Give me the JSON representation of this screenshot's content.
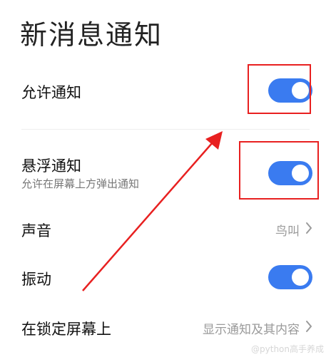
{
  "page": {
    "title": "新消息通知"
  },
  "settings": {
    "allow_notify": {
      "title": "允许通知",
      "enabled": true
    },
    "float_notify": {
      "title": "悬浮通知",
      "subtitle": "允许在屏幕上方弹出通知",
      "enabled": true
    },
    "sound": {
      "title": "声音",
      "value": "鸟叫"
    },
    "vibrate": {
      "title": "振动",
      "enabled": true
    },
    "lockscreen": {
      "title": "在锁定屏幕上",
      "value": "显示通知及其内容"
    }
  },
  "watermark": {
    "text": "@python高手养成"
  },
  "colors": {
    "toggle_on": "#3a7bf0",
    "annotation_red": "#e82020"
  },
  "icons": {
    "chevron": "chevron-right-icon",
    "toggle": "toggle-switch-icon",
    "arrow": "red-annotation-arrow-icon"
  }
}
